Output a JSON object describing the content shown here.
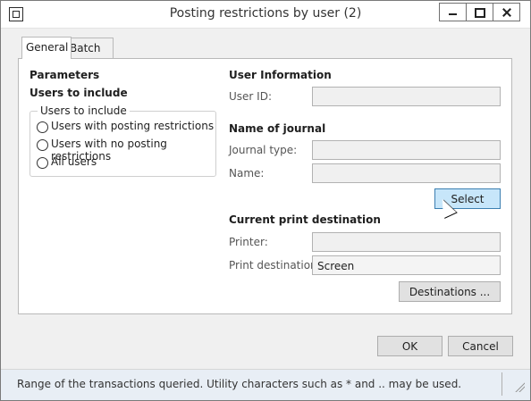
{
  "window": {
    "title": "Posting restrictions by user (2)"
  },
  "tabs": [
    "General",
    "Batch"
  ],
  "parameters": {
    "heading": "Parameters",
    "users_heading": "Users to include",
    "group_title": "Users to include",
    "options": [
      "Users with posting restrictions",
      "Users with no posting restrictions",
      "All users"
    ]
  },
  "user_info": {
    "heading": "User Information",
    "user_id_label": "User ID:",
    "user_id_value": ""
  },
  "journal": {
    "heading": "Name of journal",
    "type_label": "Journal type:",
    "type_value": "",
    "name_label": "Name:",
    "name_value": "",
    "select_label": "Select"
  },
  "print": {
    "heading": "Current print destination",
    "printer_label": "Printer:",
    "printer_value": "",
    "destination_label": "Print destination:",
    "destination_value": "Screen",
    "destinations_button": "Destinations ..."
  },
  "buttons": {
    "ok": "OK",
    "cancel": "Cancel"
  },
  "status": {
    "text": "Range of the transactions queried. Utility characters such as * and .. may be used."
  }
}
